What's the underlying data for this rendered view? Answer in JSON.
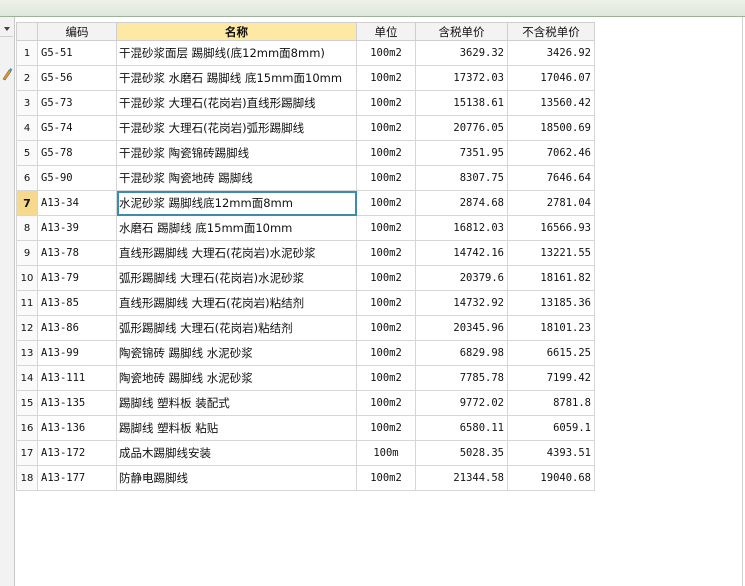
{
  "columns": {
    "code": "编码",
    "name": "名称",
    "unit": "单位",
    "price_tax": "含税单价",
    "price_notax": "不含税单价"
  },
  "icons": {
    "dropdown": "chevron-down-icon",
    "tool": "brush-icon"
  },
  "rows": [
    {
      "no": "1",
      "code": "G5-51",
      "name": "干混砂浆面层 踢脚线(底12mm面8mm)",
      "unit": "100m2",
      "price_tax": "3629.32",
      "price_notax": "3426.92"
    },
    {
      "no": "2",
      "code": "G5-56",
      "name": "干混砂浆 水磨石 踢脚线 底15mm面10mm",
      "unit": "100m2",
      "price_tax": "17372.03",
      "price_notax": "17046.07"
    },
    {
      "no": "3",
      "code": "G5-73",
      "name": "干混砂浆 大理石(花岗岩)直线形踢脚线",
      "unit": "100m2",
      "price_tax": "15138.61",
      "price_notax": "13560.42"
    },
    {
      "no": "4",
      "code": "G5-74",
      "name": "干混砂浆 大理石(花岗岩)弧形踢脚线",
      "unit": "100m2",
      "price_tax": "20776.05",
      "price_notax": "18500.69"
    },
    {
      "no": "5",
      "code": "G5-78",
      "name": "干混砂浆 陶瓷锦砖踢脚线",
      "unit": "100m2",
      "price_tax": "7351.95",
      "price_notax": "7062.46"
    },
    {
      "no": "6",
      "code": "G5-90",
      "name": "干混砂浆 陶瓷地砖 踢脚线",
      "unit": "100m2",
      "price_tax": "8307.75",
      "price_notax": "7646.64"
    },
    {
      "no": "7",
      "code": "A13-34",
      "name": "水泥砂浆 踢脚线底12mm面8mm",
      "unit": "100m2",
      "price_tax": "2874.68",
      "price_notax": "2781.04"
    },
    {
      "no": "8",
      "code": "A13-39",
      "name": "水磨石 踢脚线 底15mm面10mm",
      "unit": "100m2",
      "price_tax": "16812.03",
      "price_notax": "16566.93"
    },
    {
      "no": "9",
      "code": "A13-78",
      "name": "直线形踢脚线 大理石(花岗岩)水泥砂浆",
      "unit": "100m2",
      "price_tax": "14742.16",
      "price_notax": "13221.55"
    },
    {
      "no": "10",
      "code": "A13-79",
      "name": "弧形踢脚线 大理石(花岗岩)水泥砂浆",
      "unit": "100m2",
      "price_tax": "20379.6",
      "price_notax": "18161.82"
    },
    {
      "no": "11",
      "code": "A13-85",
      "name": "直线形踢脚线 大理石(花岗岩)粘结剂",
      "unit": "100m2",
      "price_tax": "14732.92",
      "price_notax": "13185.36"
    },
    {
      "no": "12",
      "code": "A13-86",
      "name": "弧形踢脚线 大理石(花岗岩)粘结剂",
      "unit": "100m2",
      "price_tax": "20345.96",
      "price_notax": "18101.23"
    },
    {
      "no": "13",
      "code": "A13-99",
      "name": "陶瓷锦砖 踢脚线 水泥砂浆",
      "unit": "100m2",
      "price_tax": "6829.98",
      "price_notax": "6615.25"
    },
    {
      "no": "14",
      "code": "A13-111",
      "name": "陶瓷地砖 踢脚线 水泥砂浆",
      "unit": "100m2",
      "price_tax": "7785.78",
      "price_notax": "7199.42"
    },
    {
      "no": "15",
      "code": "A13-135",
      "name": "踢脚线 塑料板 装配式",
      "unit": "100m2",
      "price_tax": "9772.02",
      "price_notax": "8781.8"
    },
    {
      "no": "16",
      "code": "A13-136",
      "name": "踢脚线 塑料板 粘贴",
      "unit": "100m2",
      "price_tax": "6580.11",
      "price_notax": "6059.1"
    },
    {
      "no": "17",
      "code": "A13-172",
      "name": "成品木踢脚线安装",
      "unit": "100m",
      "price_tax": "5028.35",
      "price_notax": "4393.51"
    },
    {
      "no": "18",
      "code": "A13-177",
      "name": "防静电踢脚线",
      "unit": "100m2",
      "price_tax": "21344.58",
      "price_notax": "19040.68"
    }
  ],
  "active_row": "7",
  "colors": {
    "header_selected": "#fde9a3",
    "active_row_number": "#f6d98c",
    "selection_border": "#3c8cb0"
  }
}
